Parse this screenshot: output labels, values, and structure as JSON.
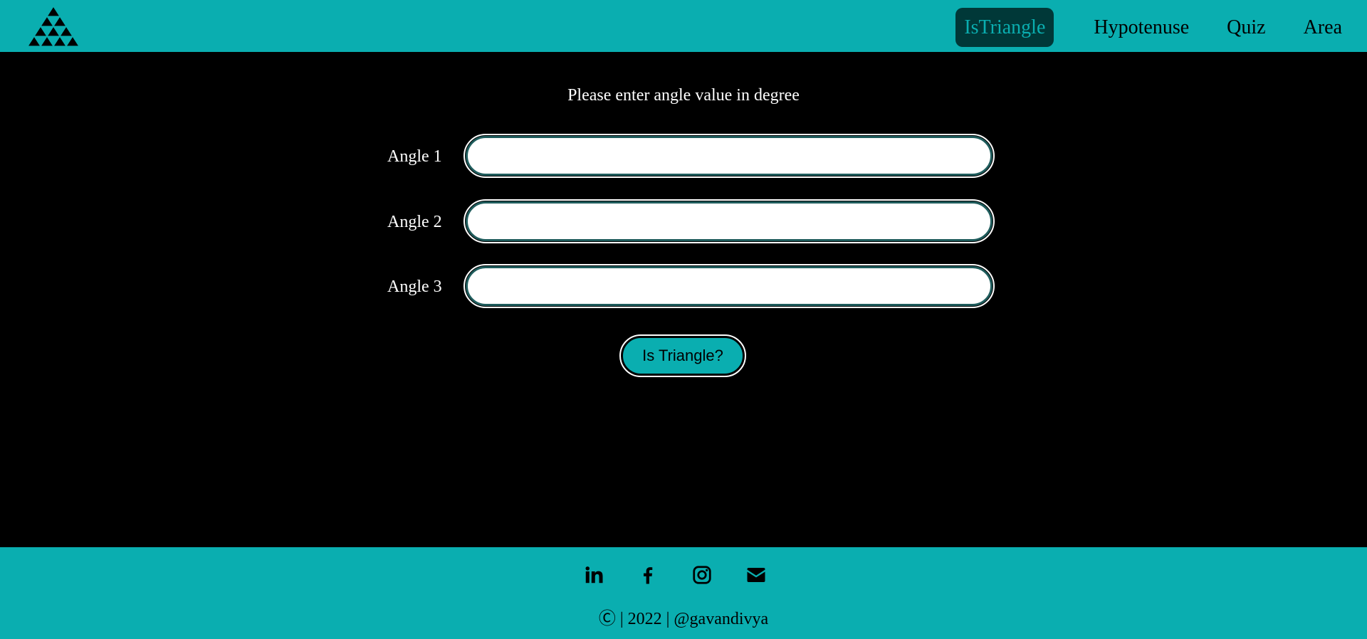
{
  "nav": {
    "logo_icon": "triangle-logo-icon",
    "links": [
      {
        "label": "IsTriangle",
        "active": true
      },
      {
        "label": "Hypotenuse",
        "active": false
      },
      {
        "label": "Quiz",
        "active": false
      },
      {
        "label": "Area",
        "active": false
      }
    ]
  },
  "main": {
    "prompt": "Please enter angle value in degree",
    "fields": [
      {
        "label": "Angle 1",
        "value": ""
      },
      {
        "label": "Angle 2",
        "value": ""
      },
      {
        "label": "Angle 3",
        "value": ""
      }
    ],
    "submit_label": "Is Triangle?"
  },
  "footer": {
    "social_icons": [
      "linkedin-icon",
      "facebook-icon",
      "instagram-icon",
      "envelope-icon"
    ],
    "copyright": "Ⓒ | 2022 | @gavandivya"
  },
  "colors": {
    "accent": "#0aaeb0",
    "active_nav_bg": "#003838",
    "background": "#000000",
    "input_border": "#1f5c5c"
  }
}
